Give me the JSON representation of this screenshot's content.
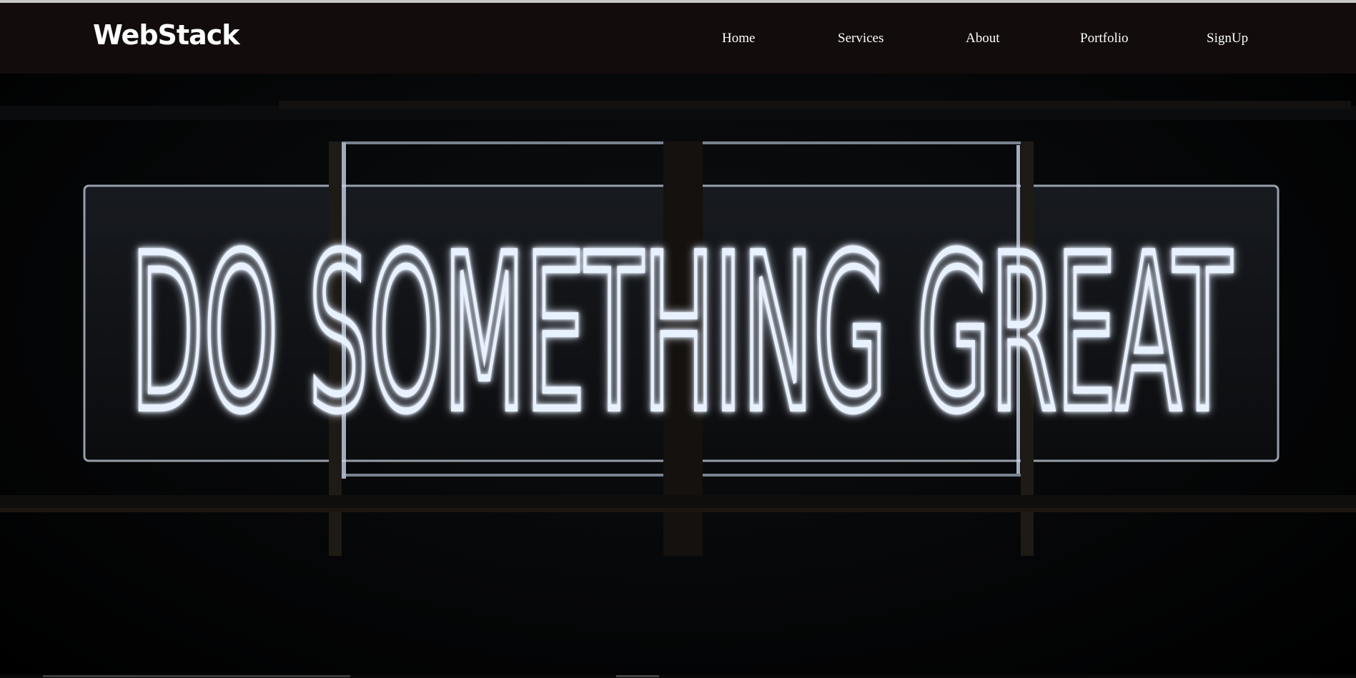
{
  "brand": {
    "name": "WebStack"
  },
  "nav": {
    "items": [
      {
        "label": "Home"
      },
      {
        "label": "Services"
      },
      {
        "label": "About"
      },
      {
        "label": "Portfolio"
      },
      {
        "label": "SignUp"
      }
    ]
  },
  "hero": {
    "sign_text": "DO SOMETHING GREAT",
    "image_subject": "neon-sign-photo"
  },
  "colors": {
    "navbar_bg": "#120c0c",
    "nav_text": "#ffffff",
    "neon": "#e8f1ff",
    "neon_glow": "#8fb4ff",
    "background": "#000000"
  }
}
